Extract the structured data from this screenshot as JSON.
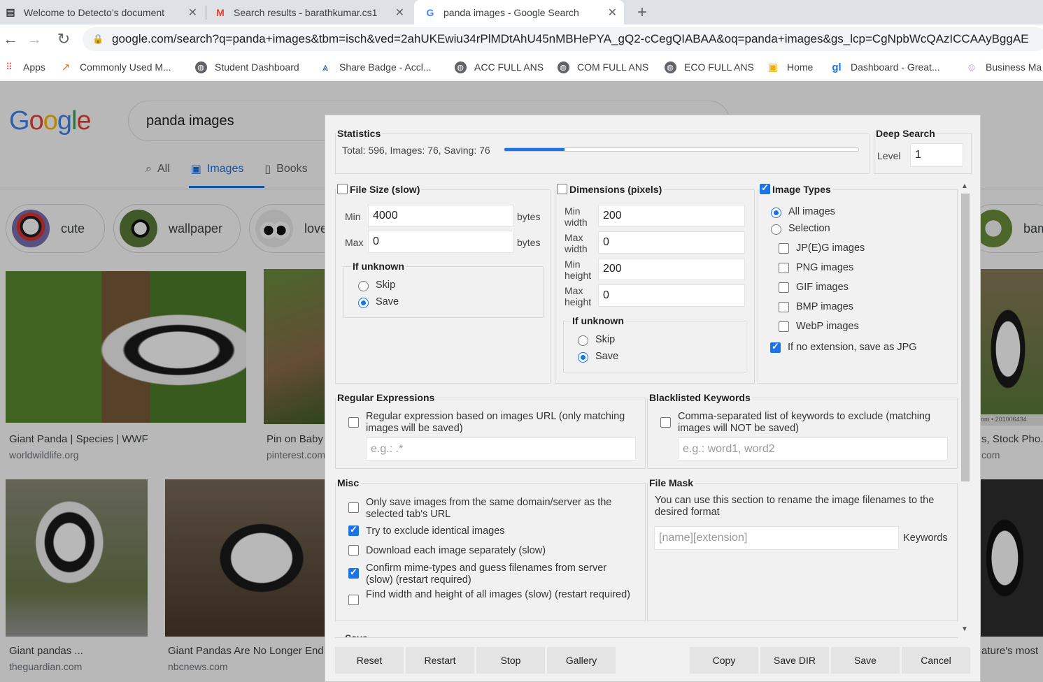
{
  "browser": {
    "tabs": [
      {
        "title": "Welcome to Detecto’s document",
        "icon": "doc-icon"
      },
      {
        "title": "Search results - barathkumar.cs1",
        "icon": "gmail-icon"
      },
      {
        "title": "panda images - Google Search",
        "icon": "google-icon"
      }
    ],
    "url": "google.com/search?q=panda+images&tbm=isch&ved=2ahUKEwiu34rPlMDtAhU45nMBHePYA_gQ2-cCegQIABAA&oq=panda+images&gs_lcp=CgNpbWcQAzICCAAyBggAE",
    "bookmarks": [
      "Apps",
      "Commonly Used M...",
      "Student Dashboard",
      "Share Badge - Accl...",
      "ACC FULL ANS",
      "COM FULL ANS",
      "ECO FULL ANS",
      "Home",
      "Dashboard - Great...",
      "Business Ma"
    ]
  },
  "google": {
    "logo": [
      "G",
      "o",
      "o",
      "g",
      "l",
      "e"
    ],
    "query": "panda images",
    "tabs": [
      "All",
      "Images",
      "Books"
    ],
    "chips": [
      "cute",
      "wallpaper",
      "love",
      "bamb"
    ],
    "results": [
      {
        "caption": "Giant Panda | Species | WWF",
        "source": "worldwildlife.org"
      },
      {
        "caption": "Pin on Baby",
        "source": "pinterest.com"
      },
      {
        "caption": "s, Stock Pho...",
        "source": "com"
      },
      {
        "caption": "Giant pandas ...",
        "source": "theguardian.com"
      },
      {
        "caption": "Giant Pandas Are No Longer End",
        "source": "nbcnews.com"
      },
      {
        "caption": "ature's most",
        "source": ""
      }
    ],
    "stock_tag": "om • 201006434"
  },
  "dialog": {
    "statistics": {
      "legend": "Statistics",
      "text": "Total: 596, Images: 76, Saving: 76",
      "progress_fraction": 0.17
    },
    "deep_search": {
      "legend": "Deep Search",
      "level_label": "Level",
      "level_value": "1"
    },
    "file_size": {
      "legend": "File Size (slow)",
      "enabled": false,
      "min_label": "Min",
      "min_value": "4000",
      "max_label": "Max",
      "max_value": "0",
      "unit": "bytes",
      "unknown_legend": "If unknown",
      "skip": "Skip",
      "save": "Save",
      "selected": "save"
    },
    "dimensions": {
      "legend": "Dimensions (pixels)",
      "enabled": false,
      "fields": [
        {
          "label1": "Min",
          "label2": "width",
          "value": "200"
        },
        {
          "label1": "Max",
          "label2": "width",
          "value": "0"
        },
        {
          "label1": "Min",
          "label2": "height",
          "value": "200"
        },
        {
          "label1": "Max",
          "label2": "height",
          "value": "0"
        }
      ],
      "unknown_legend": "If unknown",
      "skip": "Skip",
      "save": "Save",
      "selected": "save"
    },
    "image_types": {
      "legend": "Image Types",
      "enabled": true,
      "all": "All images",
      "selection": "Selection",
      "selected": "all",
      "types": [
        {
          "label": "JP(E)G images",
          "checked": false
        },
        {
          "label": "PNG images",
          "checked": false
        },
        {
          "label": "GIF images",
          "checked": false
        },
        {
          "label": "BMP images",
          "checked": false
        },
        {
          "label": "WebP images",
          "checked": false
        }
      ],
      "noext_label": "If no extension, save as JPG",
      "noext_checked": true
    },
    "regex": {
      "legend": "Regular Expressions",
      "checked": false,
      "label": "Regular expression based on images URL (only matching images will be saved)",
      "placeholder": "e.g.: .*"
    },
    "blacklist": {
      "legend": "Blacklisted Keywords",
      "checked": false,
      "label": "Comma-separated list of keywords to exclude (matching images will NOT be saved)",
      "placeholder": "e.g.: word1, word2"
    },
    "misc": {
      "legend": "Misc",
      "options": [
        {
          "label": "Only save images from the same domain/server as the selected tab's URL",
          "checked": false
        },
        {
          "label": "Try to exclude identical images",
          "checked": true
        },
        {
          "label": "Download each image separately (slow)",
          "checked": false
        },
        {
          "label": "Confirm mime-types and guess filenames from server (slow) (restart required)",
          "checked": true
        },
        {
          "label": "Find width and height of all images (slow) (restart required)",
          "checked": false
        }
      ]
    },
    "file_mask": {
      "legend": "File Mask",
      "description": "You can use this section to rename the image filenames to the desired format",
      "placeholder": "[name][extension]",
      "keywords_label": "Keywords"
    },
    "save_legend": "Save",
    "buttons": {
      "reset": "Reset",
      "restart": "Restart",
      "stop": "Stop",
      "gallery": "Gallery",
      "copy": "Copy",
      "save_dir": "Save DIR",
      "save": "Save",
      "cancel": "Cancel"
    }
  }
}
